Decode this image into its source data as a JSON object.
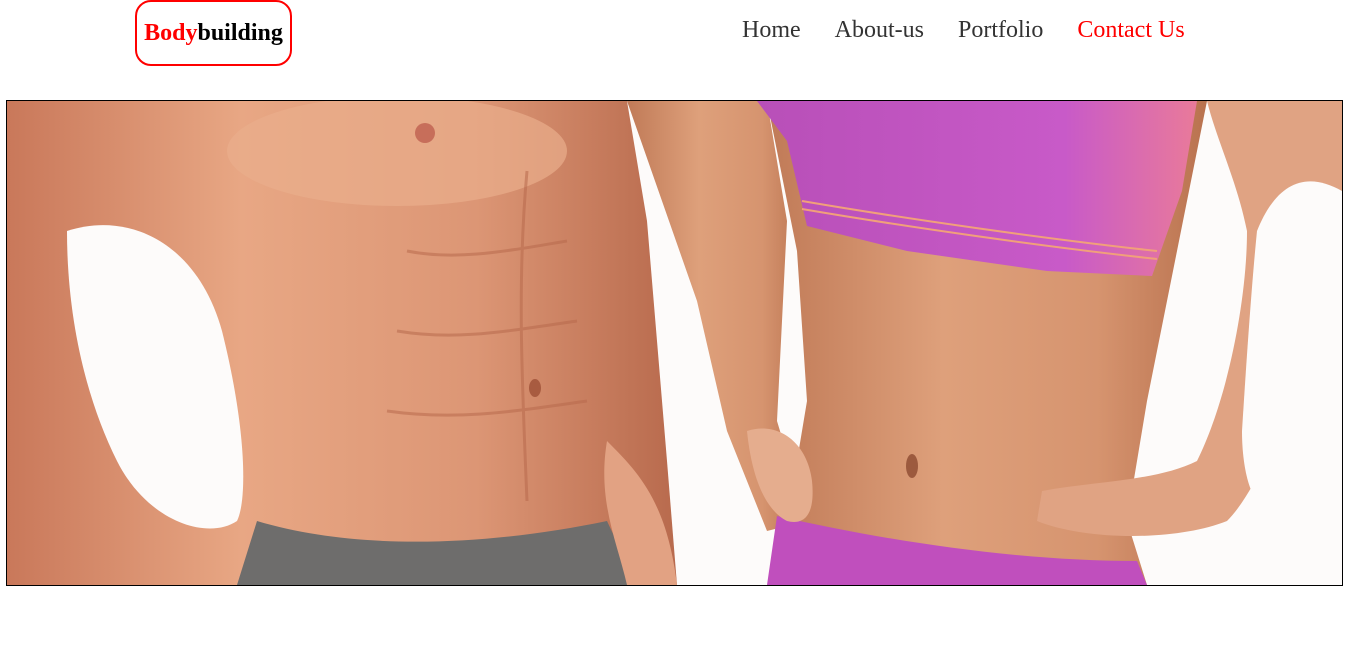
{
  "logo": {
    "part1": "Body",
    "part2": "building",
    "accent_color": "#ff0000"
  },
  "nav": {
    "items": [
      {
        "label": "Home"
      },
      {
        "label": "About-us"
      },
      {
        "label": "Portfolio"
      },
      {
        "label": "Contact Us"
      }
    ],
    "active_index": 3,
    "active_color": "#ff0000"
  },
  "hero": {
    "image_subject": "fitness-torsos-image"
  }
}
